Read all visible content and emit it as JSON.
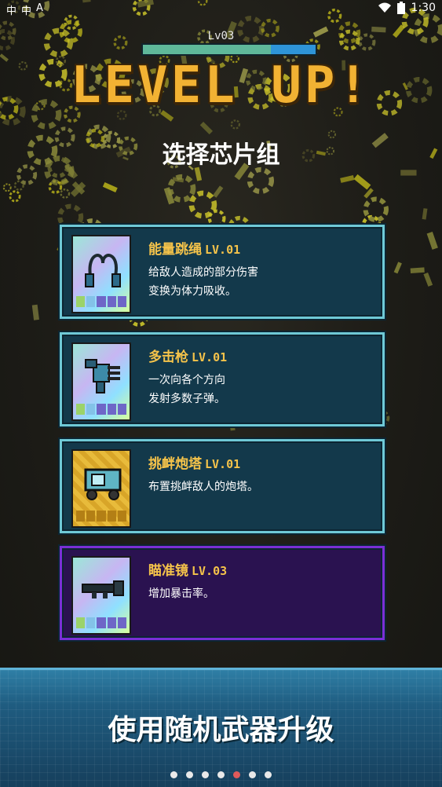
{
  "status_bar": {
    "left_icons": [
      "中",
      "中",
      "A"
    ],
    "time": "1:30"
  },
  "level": {
    "label": "Lv03",
    "progress": 0.74
  },
  "headline": "LEVEL UP!",
  "subtitle": "选择芯片组",
  "chips": [
    {
      "name": "能量跳绳",
      "level": "LV.01",
      "description": "给敌人造成的部分伤害\n变换为体力吸收。",
      "style": "teal",
      "icon": "jump-rope-icon"
    },
    {
      "name": "多击枪",
      "level": "LV.01",
      "description": "一次向各个方向\n发射多数子弹。",
      "style": "teal",
      "icon": "multi-gun-icon"
    },
    {
      "name": "挑衅炮塔",
      "level": "LV.01",
      "description": "布置挑衅敌人的炮塔。",
      "style": "gold",
      "icon": "turret-icon"
    },
    {
      "name": "瞄准镜",
      "level": "LV.03",
      "description": "增加暴击率。",
      "style": "purple",
      "icon": "scope-icon"
    }
  ],
  "banner": {
    "text": "使用随机武器升级"
  },
  "pager": {
    "count": 7,
    "active_index": 4
  },
  "colors": {
    "headline": "#f2b233",
    "card_border": "#6fc9d6",
    "card_selected_border": "#7b2fd6",
    "title_text": "#f5c34a"
  }
}
